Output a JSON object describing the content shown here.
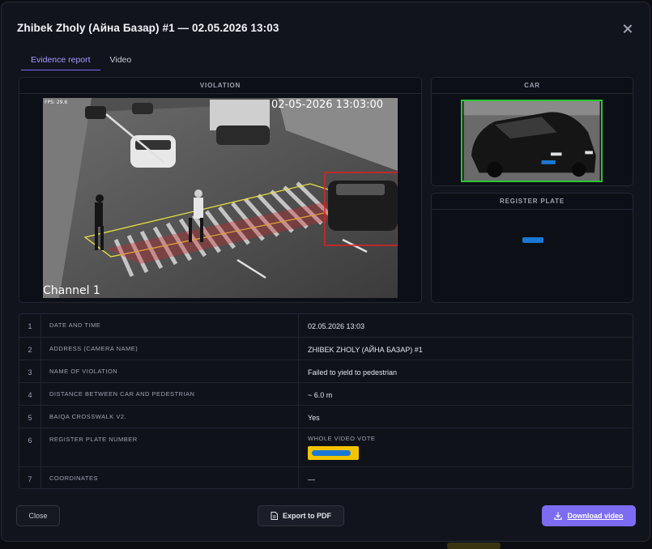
{
  "dialog": {
    "title": "Zhibek Zholy (Айна Базар) #1 — 02.05.2026 13:03"
  },
  "tabs": [
    {
      "label": "Evidence report",
      "active": true
    },
    {
      "label": "Video",
      "active": false
    }
  ],
  "panels": {
    "violation": "VIOLATION",
    "car": "CAR",
    "register_plate": "REGISTER PLATE"
  },
  "video_overlay": {
    "fps": "FPS: 29.6",
    "timestamp": "02-05-2026 13:03:00",
    "channel": "Channel 1"
  },
  "details": [
    {
      "num": "1",
      "key": "DATE AND TIME",
      "value": "02.05.2026 13:03"
    },
    {
      "num": "2",
      "key": "ADDRESS (CAMERA NAME)",
      "value": "ZHIBEK ZHOLY (АЙНА БАЗАР) #1"
    },
    {
      "num": "3",
      "key": "NAME OF VIOLATION",
      "value": "Failed to yield to pedestrian"
    },
    {
      "num": "4",
      "key": "DISTANCE BETWEEN CAR AND PEDESTRIAN",
      "value": "~ 6.0 m"
    },
    {
      "num": "5",
      "key": "BAIQA CROSSWALK V2.",
      "value": "Yes"
    },
    {
      "num": "6",
      "key": "REGISTER PLATE NUMBER",
      "value_label": "WHOLE VIDEO VOTE"
    },
    {
      "num": "7",
      "key": "COORDINATES",
      "value": "—"
    }
  ],
  "buttons": {
    "close": "Close",
    "export_pdf": "Export to PDF",
    "download_video": "Download video"
  },
  "colors": {
    "accent": "#7c6cf2",
    "detection_box": "#2fc437",
    "plate_yellow": "#f2c400"
  }
}
